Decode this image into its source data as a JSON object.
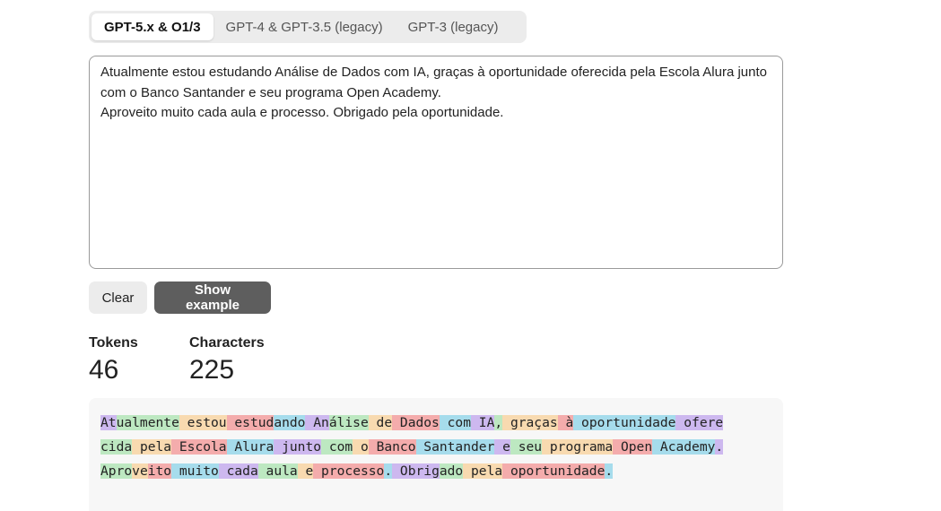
{
  "tabs": [
    {
      "label": "GPT-5.x & O1/3",
      "active": true
    },
    {
      "label": "GPT-4 & GPT-3.5 (legacy)",
      "active": false
    },
    {
      "label": "GPT-3 (legacy)",
      "active": false
    }
  ],
  "input": {
    "value": "Atualmente estou estudando Análise de Dados com IA, graças à oportunidade oferecida pela Escola Alura junto com o Banco Santander e seu programa Open Academy.\nAproveito muito cada aula e processo. Obrigado pela oportunidade."
  },
  "buttons": {
    "clear": "Clear",
    "show_example": "Show example"
  },
  "stats": {
    "tokens_label": "Tokens",
    "tokens_value": "46",
    "characters_label": "Characters",
    "characters_value": "225"
  },
  "tokens": [
    "At",
    "ualmente",
    " estou",
    " estud",
    "ando",
    " An",
    "álise",
    " de",
    " Dados",
    " com",
    " IA",
    ",",
    " graças",
    " à",
    " oportunidade",
    " ofere",
    "cida",
    " pela",
    " Escola",
    " Alura",
    " junto",
    " com",
    " o",
    " Banco",
    " Santander",
    " e",
    " seu",
    " programa",
    " Open",
    " Academy",
    ".",
    "\n",
    "Apro",
    "ve",
    "ito",
    " muito",
    " cada",
    " aula",
    " e",
    " processo",
    ".",
    " Obrig",
    "ado",
    " pela",
    " oportunidade",
    "."
  ],
  "colors": {
    "palette": [
      "#cdb8ef",
      "#bde8c1",
      "#f8dab0",
      "#f4acac",
      "#a6dcec"
    ],
    "primary_button": "#5e5e5e",
    "secondary_button": "#ececec"
  }
}
